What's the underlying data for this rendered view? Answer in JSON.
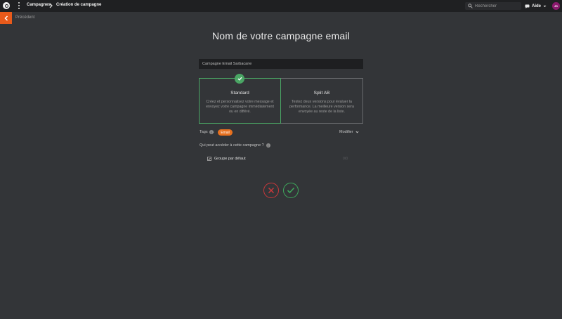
{
  "header": {
    "logo_icon": "sarbacane-logo-icon",
    "menu_icon": "kebab-menu-icon",
    "breadcrumb": [
      "Campagnes",
      "Création de campagne"
    ],
    "search_placeholder": "Rechercher",
    "help_label": "Aide",
    "avatar_initials": "JS",
    "avatar_color": "#8b1a6e"
  },
  "back": {
    "label": "Précédent",
    "accent": "#e85a1b"
  },
  "title": "Nom de votre campagne email",
  "campaign_name": "Campagne Email Sarbacane",
  "campaign_types": [
    {
      "title": "Standard",
      "description": "Créez et personnalisez votre message et envoyez votre campagne immédiatement ou en différé.",
      "selected": true
    },
    {
      "title": "Split AB",
      "description": "Testez deux versions pour évaluer la performance. La meilleure version sera envoyée au reste de la liste.",
      "selected": false
    }
  ],
  "tags": {
    "label": "Tags",
    "separator": ":",
    "items": [
      "Email"
    ],
    "modify_label": "Modifier"
  },
  "access": {
    "question": "Qui peut accéder à cette campagne ?",
    "groups": [
      {
        "label": "Groupe par défaut",
        "checked": true,
        "count": "0/0"
      }
    ]
  },
  "colors": {
    "selected": "#4aa564",
    "cancel": "#c9383b",
    "confirm": "#3ea85c",
    "tag": "#e8711f"
  }
}
